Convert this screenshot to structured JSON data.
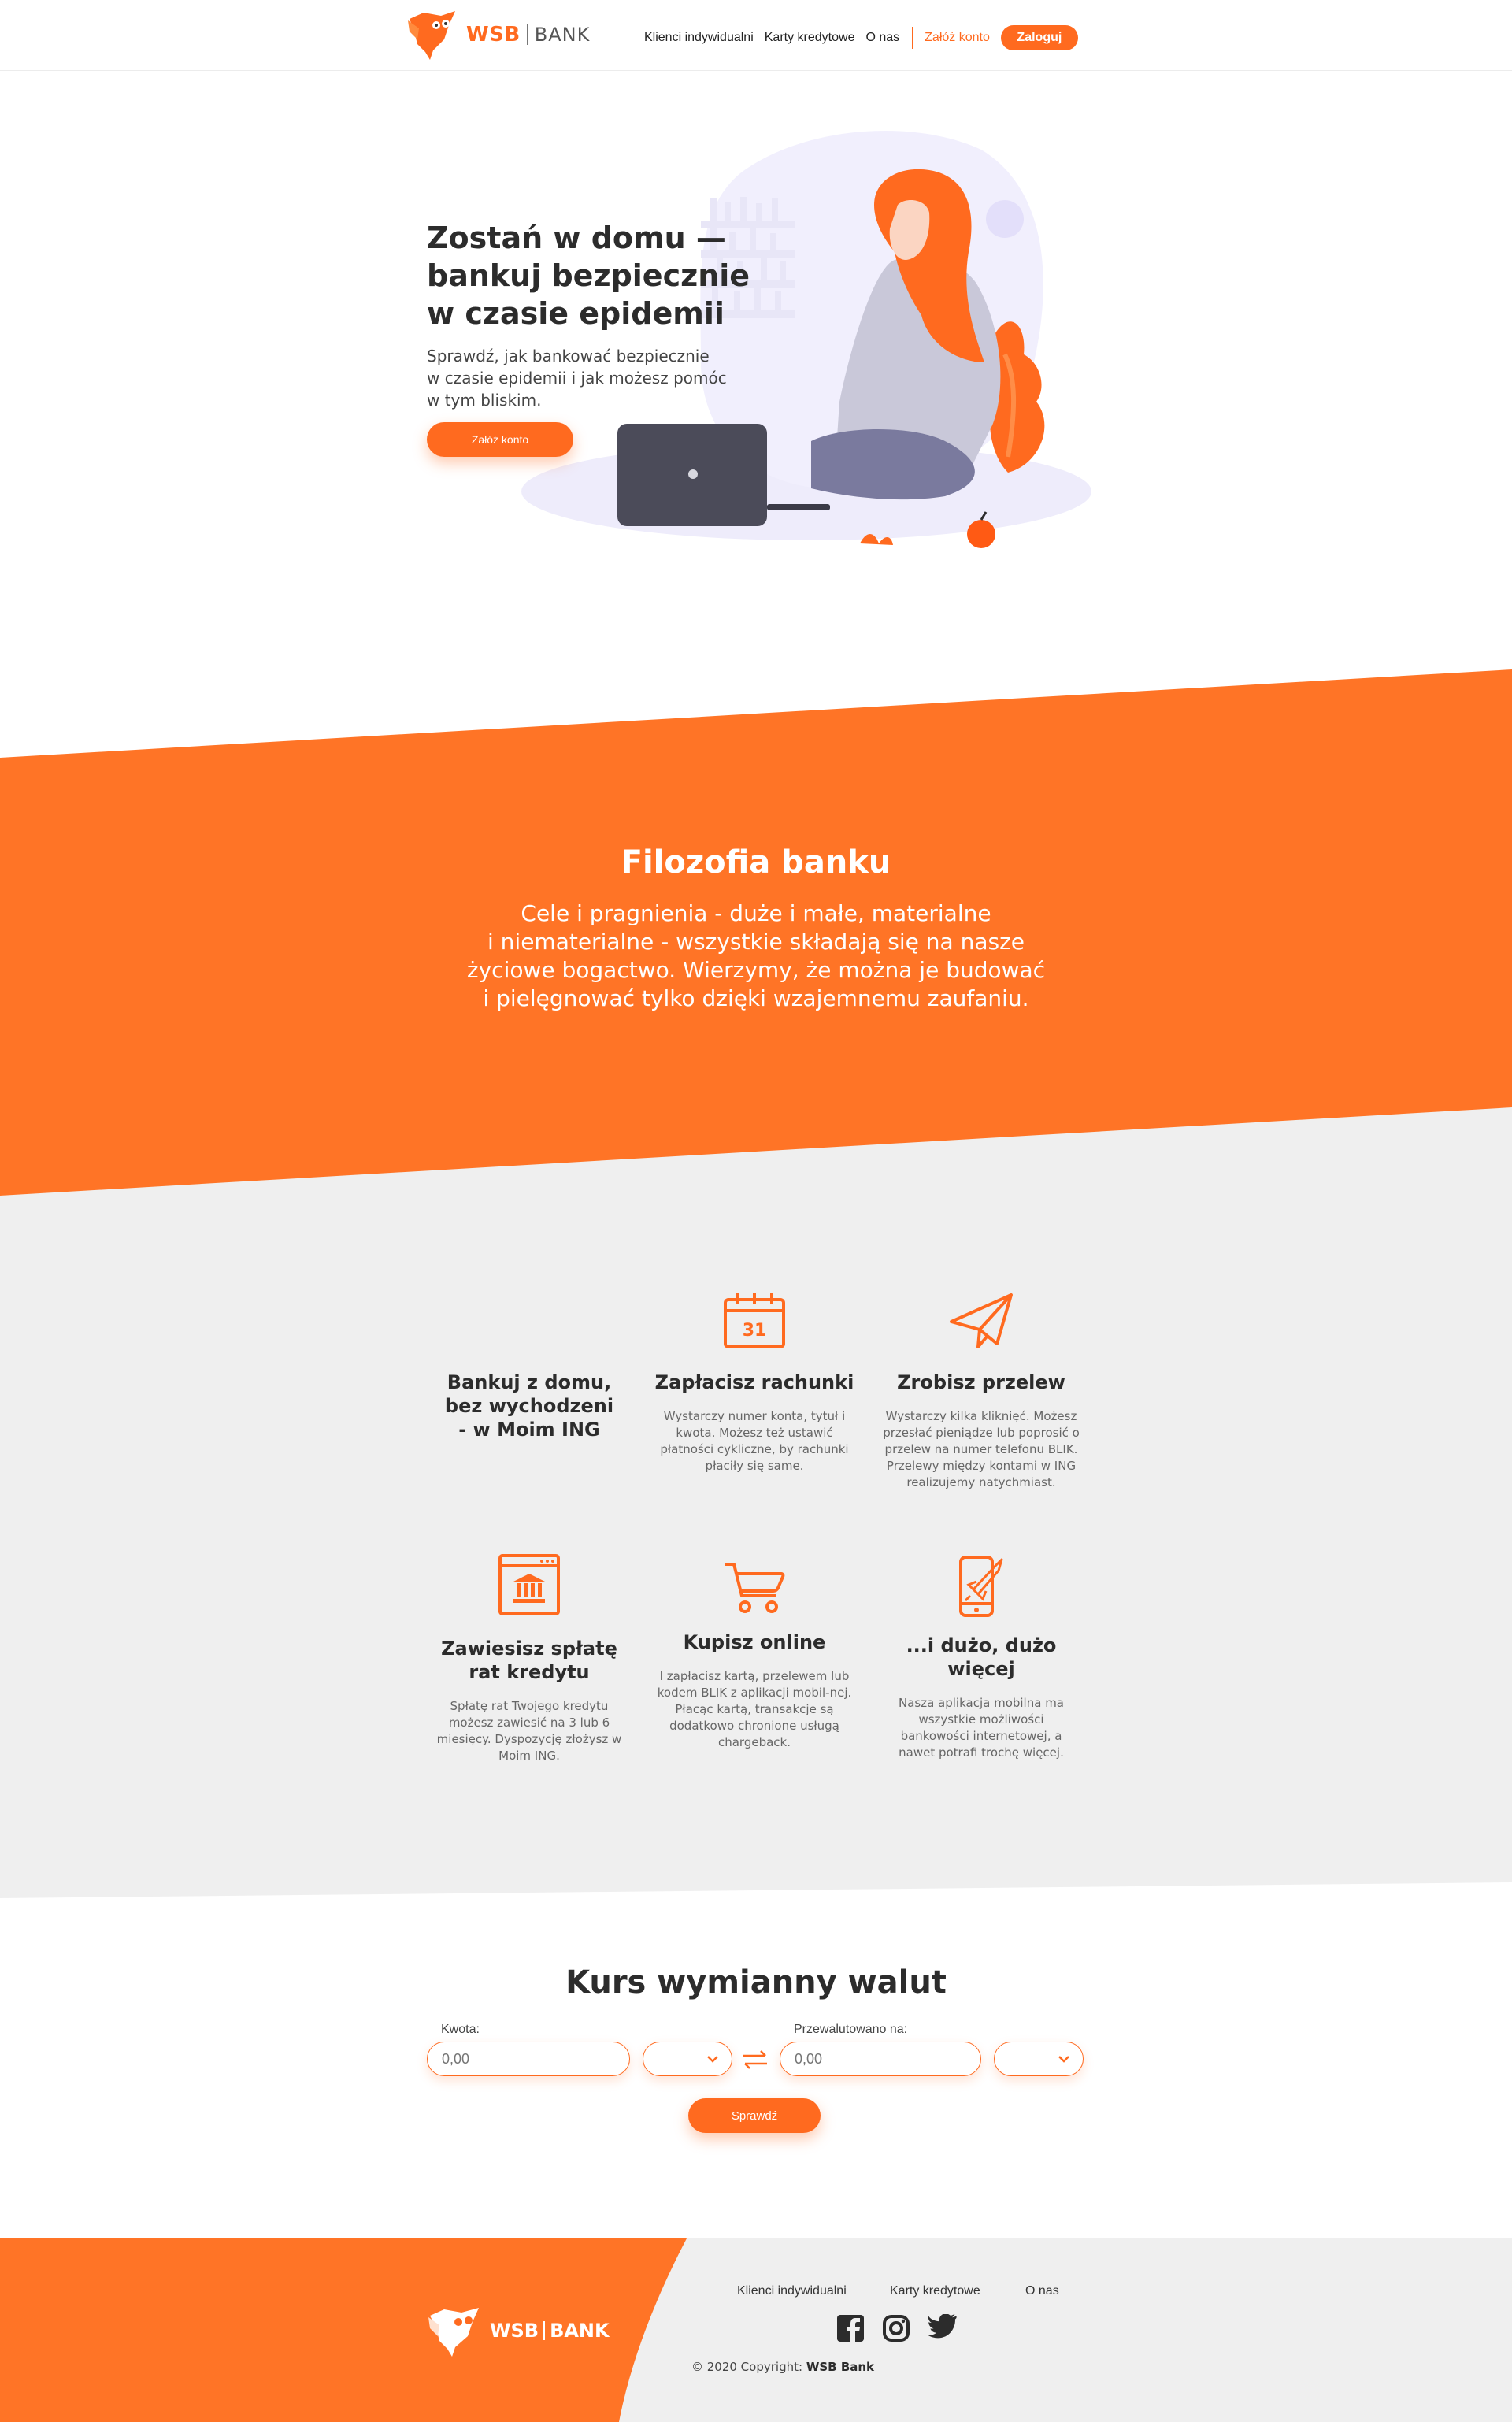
{
  "colors": {
    "accent": "#ff6a1f",
    "panel": "#efefef",
    "text": "#2c2c2c"
  },
  "brand": {
    "name": "WSB",
    "suffix": "BANK"
  },
  "nav": {
    "links": [
      "Klienci indywidualni",
      "Karty kredytowe",
      "O nas"
    ],
    "signup": "Załóż konto",
    "login": "Zaloguj"
  },
  "hero": {
    "title_line1": "Zostań w domu —",
    "title_line2": "bankuj bezpiecznie",
    "title_line3": "w czasie epidemii",
    "subtitle_line1": "Sprawdź, jak bankować bezpiecznie",
    "subtitle_line2": "w czasie epidemii i jak możesz pomóc",
    "subtitle_line3": "w tym bliskim.",
    "cta": "Załóż konto"
  },
  "philosophy": {
    "title": "Filozofia banku",
    "line1": "Cele i pragnienia - duże i małe, materialne",
    "line2": "i niematerialne - wszystkie składają się na nasze",
    "line3": "życiowe bogactwo. Wierzymy, że można je budować",
    "line4": "i pielęgnować tylko dzięki wzajemnemu zaufaniu."
  },
  "features": [
    {
      "icon": "none",
      "title_l1": "Bankuj z domu,",
      "title_l2": "bez wychodzeni",
      "title_l3": "- w Moim ING",
      "text": ""
    },
    {
      "icon": "calendar-icon",
      "calendar_day": "31",
      "title_l1": "Zapłacisz rachunki",
      "text": "Wystarczy numer konta, tytuł i kwota. Możesz też ustawić płatności cykliczne, by rachunki płaciły się same."
    },
    {
      "icon": "paper-plane-icon",
      "title_l1": "Zrobisz przelew",
      "text": "Wystarczy kilka kliknięć. Możesz przesłać pieniądze lub poprosić o przelew na numer telefonu BLIK. Przelewy między kontami w ING realizujemy natychmiast."
    },
    {
      "icon": "bank-icon",
      "title_l1": "Zawiesisz spłatę",
      "title_l2": "rat kredytu",
      "text": "Spłatę rat Twojego kredytu możesz zawiesić na 3 lub 6 miesięcy. Dyspozycję złożysz w Moim ING."
    },
    {
      "icon": "shopping-cart-icon",
      "title_l1": "Kupisz online",
      "text": "I zapłacisz kartą, przelewem lub kodem BLIK z aplikacji mobil-nej. Płacąc kartą, transakcje są dodatkowo chronione usługą chargeback."
    },
    {
      "icon": "mobile-rocket-icon",
      "title_l1": "...i dużo, dużo więcej",
      "text": "Nasza aplikacja mobilna ma wszystkie możliwości bankowości internetowej, a nawet potrafi trochę więcej."
    }
  ],
  "exchange": {
    "title": "Kurs wymianny walut",
    "amount_label": "Kwota:",
    "amount_placeholder": "0,00",
    "converted_label": "Przewalutowano na:",
    "converted_placeholder": "0,00",
    "submit": "Sprawdź"
  },
  "footer": {
    "links": [
      "Klienci indywidualni",
      "Karty kredytowe",
      "O nas"
    ],
    "social": [
      "facebook-icon",
      "instagram-icon",
      "twitter-icon"
    ],
    "copyright_prefix": "© 2020 Copyright:",
    "copyright_brand": "WSB Bank"
  }
}
